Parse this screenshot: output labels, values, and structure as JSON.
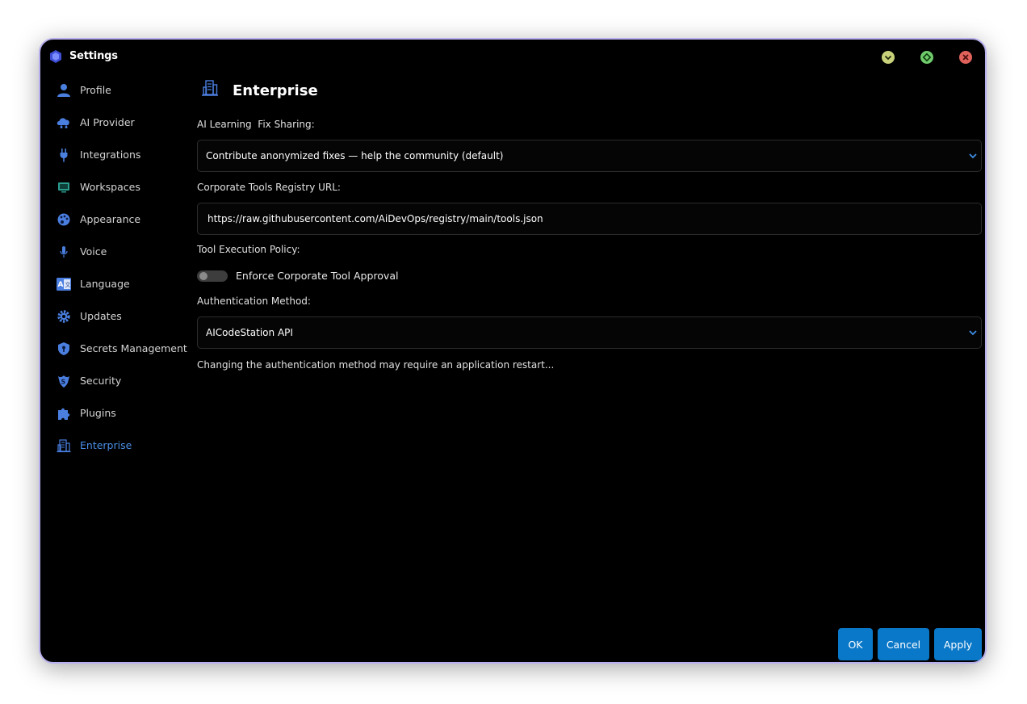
{
  "window": {
    "title": "Settings"
  },
  "colors": {
    "accent": "#0a78c8",
    "active_nav": "#4a8ee6",
    "minimize": "#c9d27a",
    "maximize": "#6fcb6b",
    "close": "#e0625b"
  },
  "sidebar": {
    "items": [
      {
        "label": "Profile",
        "icon": "user-icon"
      },
      {
        "label": "AI Provider",
        "icon": "ai-cloud-icon"
      },
      {
        "label": "Integrations",
        "icon": "plug-icon"
      },
      {
        "label": "Workspaces",
        "icon": "monitor-icon"
      },
      {
        "label": "Appearance",
        "icon": "palette-icon"
      },
      {
        "label": "Voice",
        "icon": "microphone-icon"
      },
      {
        "label": "Language",
        "icon": "translate-icon"
      },
      {
        "label": "Updates",
        "icon": "gear-icon"
      },
      {
        "label": "Secrets Management",
        "icon": "shield-key-icon"
      },
      {
        "label": "Security",
        "icon": "security-icon"
      },
      {
        "label": "Plugins",
        "icon": "puzzle-icon"
      },
      {
        "label": "Enterprise",
        "icon": "building-icon",
        "active": true
      }
    ]
  },
  "main": {
    "title": "Enterprise",
    "ai_learning": {
      "label": "AI Learning  Fix Sharing:",
      "value": "Contribute anonymized fixes — help the community (default)"
    },
    "registry": {
      "label": "Corporate Tools Registry URL:",
      "value": "https://raw.githubusercontent.com/AiDevOps/registry/main/tools.json"
    },
    "tool_policy": {
      "label": "Tool Execution Policy:",
      "toggle_label": "Enforce Corporate Tool Approval",
      "enabled": false
    },
    "auth": {
      "label": "Authentication Method:",
      "value": "AICodeStation API",
      "note": "Changing the authentication method may require an application restart..."
    }
  },
  "footer": {
    "ok_label": "OK",
    "cancel_label": "Cancel",
    "apply_label": "Apply"
  }
}
